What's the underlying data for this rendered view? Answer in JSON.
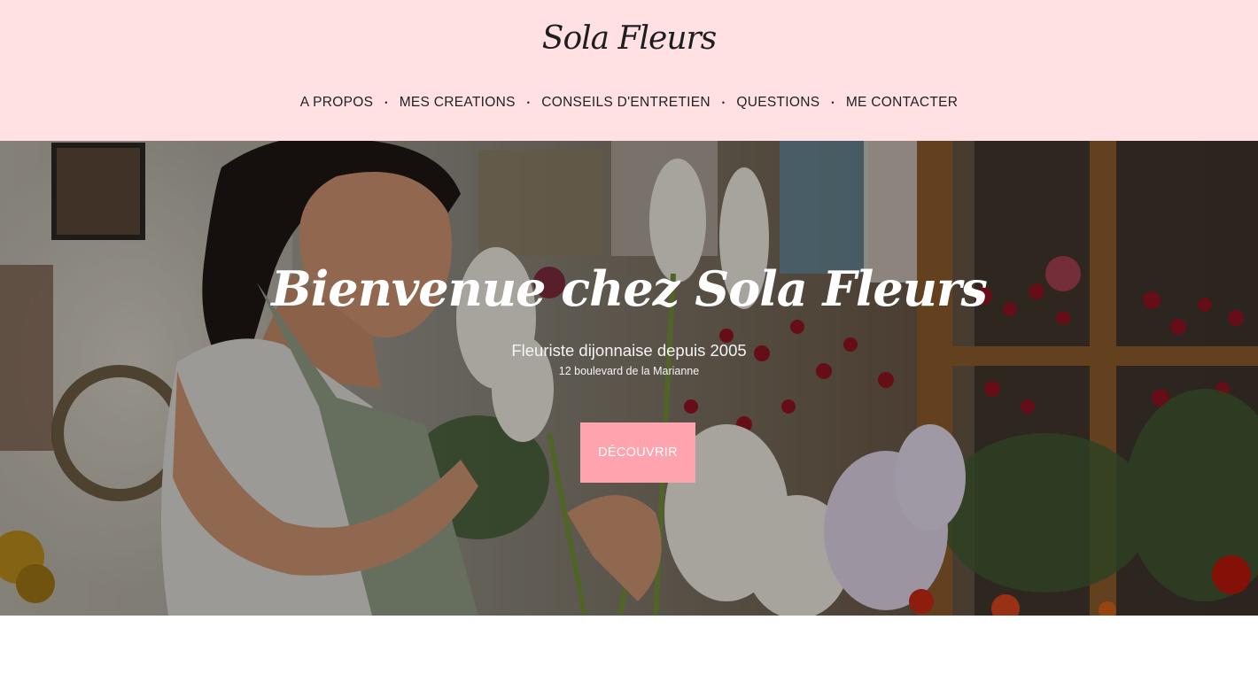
{
  "brand": {
    "logo_text": "Sola Fleurs"
  },
  "nav": {
    "items": [
      {
        "label": "A PROPOS"
      },
      {
        "label": "MES CREATIONS"
      },
      {
        "label": "CONSEILS D'ENTRETIEN"
      },
      {
        "label": "QUESTIONS"
      },
      {
        "label": "ME CONTACTER"
      }
    ],
    "separator": "•"
  },
  "hero": {
    "title": "Bienvenue chez Sola Fleurs",
    "subtitle": "Fleuriste dijonnaise depuis 2005",
    "address": "12 boulevard de la Marianne",
    "cta_label": "DÉCOUVRIR",
    "image": "florist-arranging-flowers-photo"
  },
  "colors": {
    "header_bg": "#ffe1e4",
    "accent": "#ffa3af",
    "text": "#222222"
  }
}
